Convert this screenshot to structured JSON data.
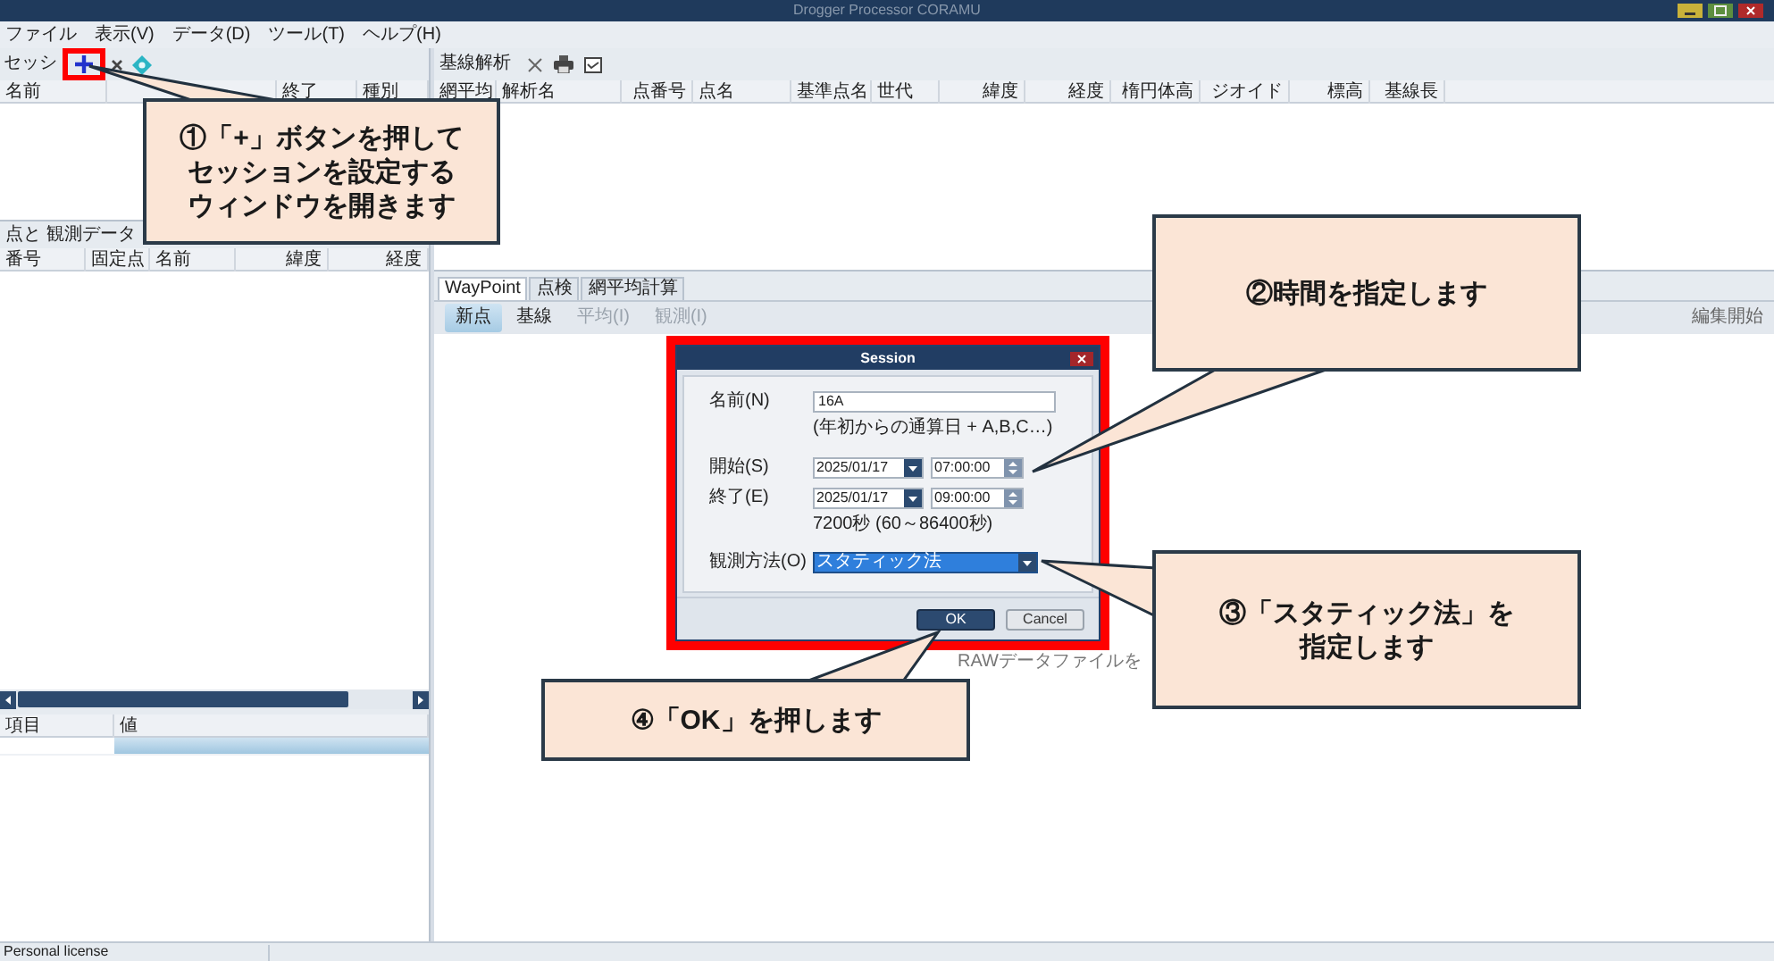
{
  "window": {
    "title": "Drogger Processor CORAMU"
  },
  "menu": [
    {
      "label": "ファイル"
    },
    {
      "label": "表示(V)"
    },
    {
      "label": "データ(D)"
    },
    {
      "label": "ツール(T)"
    },
    {
      "label": "ヘルプ(H)"
    }
  ],
  "session_panel": {
    "title": "セッシ",
    "columns": [
      "名前",
      "終了",
      "種別"
    ]
  },
  "points_panel": {
    "title": "点と 観測データ",
    "columns": [
      "番号",
      "固定点",
      "名前",
      "緯度",
      "経度"
    ]
  },
  "properties": {
    "columns": [
      "項目",
      "値"
    ]
  },
  "status_bar": {
    "text": "Personal license"
  },
  "baseline_panel": {
    "title": "基線解析",
    "columns": [
      "網平均",
      "解析名",
      "点番号",
      "点名",
      "基準点名",
      "世代",
      "緯度",
      "経度",
      "楕円体高",
      "ジオイド",
      "標高",
      "基線長"
    ]
  },
  "tabs": [
    {
      "label": "WayPoint",
      "selected": true
    },
    {
      "label": "点検",
      "selected": false
    },
    {
      "label": "網平均計算",
      "selected": false
    }
  ],
  "toolbar": [
    {
      "label": "新点",
      "selected": true,
      "disabled": false
    },
    {
      "label": "基線",
      "selected": false,
      "disabled": false
    },
    {
      "label": "平均(I)",
      "selected": false,
      "disabled": true
    },
    {
      "label": "観測(I)",
      "selected": false,
      "disabled": true
    }
  ],
  "edit_button": "編集開始",
  "hint": "RAWデータファイルを",
  "dialog": {
    "title": "Session",
    "name_label": "名前(N)",
    "name_value": "16A",
    "name_hint": "(年初からの通算日 + A,B,C…)",
    "start_label": "開始(S)",
    "start_date": "2025/01/17",
    "start_time": "07:00:00",
    "end_label": "終了(E)",
    "end_date": "2025/01/17",
    "end_time": "09:00:00",
    "duration": "7200秒 (60～86400秒)",
    "method_label": "観測方法(O)",
    "method_value": "スタティック法",
    "buttons": [
      "OK",
      "Cancel"
    ]
  },
  "callouts": [
    {
      "lines": [
        "①「+」ボタンを押して",
        "セッションを設定する",
        "ウィンドウを開きます"
      ]
    },
    {
      "lines": [
        "②時間を指定します"
      ]
    },
    {
      "lines": [
        "③「スタティック法」を",
        "指定します"
      ]
    },
    {
      "lines": [
        "④「OK」を押します"
      ]
    }
  ]
}
